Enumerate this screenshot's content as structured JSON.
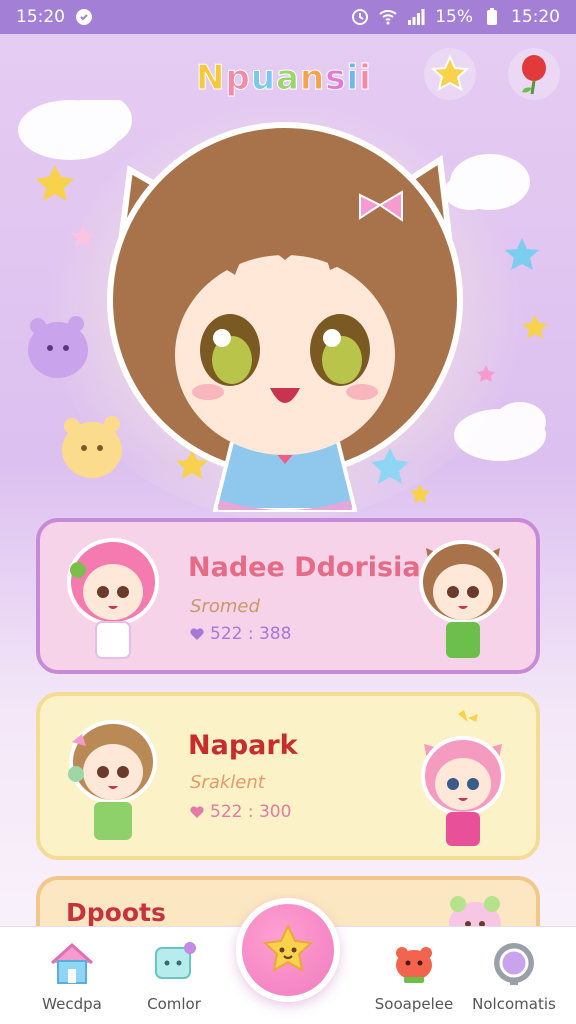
{
  "status_bar": {
    "time_left": "15:20",
    "battery_percent": "15%",
    "time_right": "15:20"
  },
  "header": {
    "title": "Npuansii",
    "star_button_icon": "star-icon",
    "balloon_button_icon": "balloon-icon"
  },
  "cards": [
    {
      "title": "Nadee Ddorisia",
      "subtitle": "Sromed",
      "meta": "522 : 388",
      "accent": "#c78ad8"
    },
    {
      "title": "Napark",
      "subtitle": "Sraklent",
      "meta": "522 : 300",
      "accent": "#f4dc92"
    },
    {
      "title": "Dpoots",
      "accent": "#f2c78c"
    }
  ],
  "nav": {
    "items": [
      {
        "label": "Wecdpa",
        "icon": "house-icon"
      },
      {
        "label": "Comlor",
        "icon": "chat-icon"
      },
      {
        "label": "",
        "icon": "star-fab-icon"
      },
      {
        "label": "Sooapelee",
        "icon": "heart-icon"
      },
      {
        "label": "Nolcomatis",
        "icon": "settings-icon"
      }
    ]
  },
  "colors": {
    "status_bar": "#a47fd6",
    "background_top": "#e6cdf2",
    "fab": "#f07cc0"
  }
}
